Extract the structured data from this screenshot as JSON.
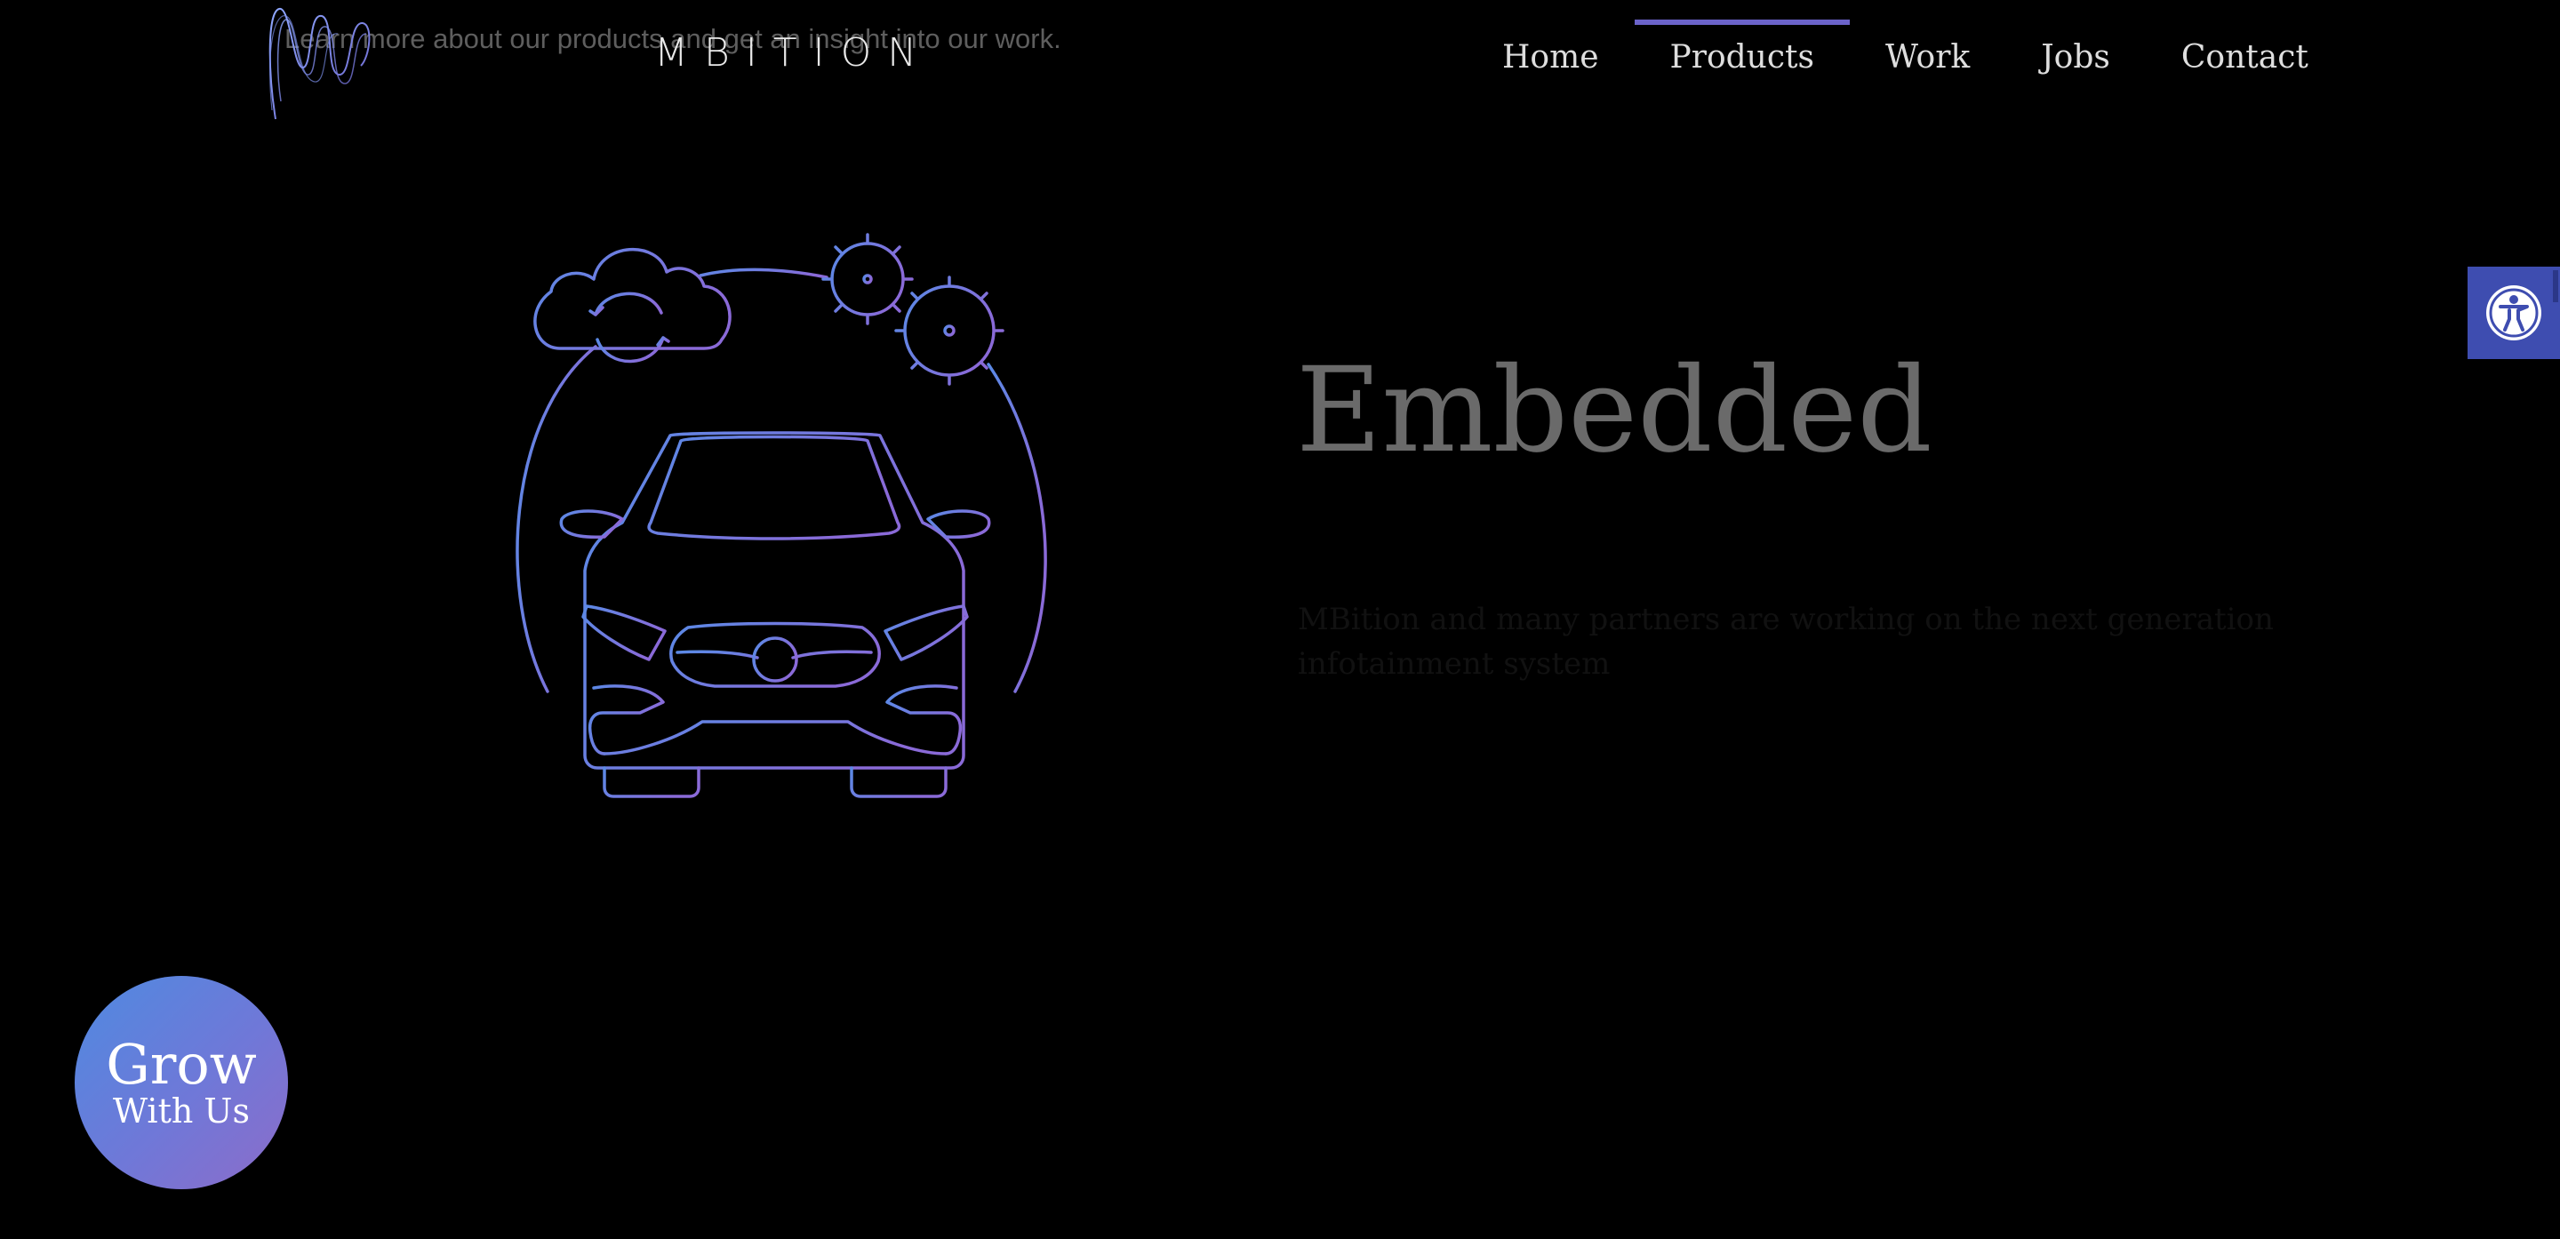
{
  "header": {
    "tagline": "Learn more about our products and get an insight into our work.",
    "logo_text": "MBITION"
  },
  "nav": {
    "items": [
      {
        "label": "Home",
        "active": false
      },
      {
        "label": "Products",
        "active": true
      },
      {
        "label": "Work",
        "active": false
      },
      {
        "label": "Jobs",
        "active": false
      },
      {
        "label": "Contact",
        "active": false
      }
    ]
  },
  "hero": {
    "title": "Embedded",
    "description": "MBition and many partners are working on the next generation infotainment system"
  },
  "badge": {
    "line1": "Grow",
    "line2": "With Us"
  },
  "icons": {
    "illustration": "car-with-cloud-and-gears-icon",
    "accessibility": "accessibility-icon"
  },
  "colors": {
    "background": "#000000",
    "accent": "#6b63c9",
    "illustration_start": "#5a8ae6",
    "illustration_end": "#8a6ad8",
    "accessibility_button": "#3e4db0"
  }
}
